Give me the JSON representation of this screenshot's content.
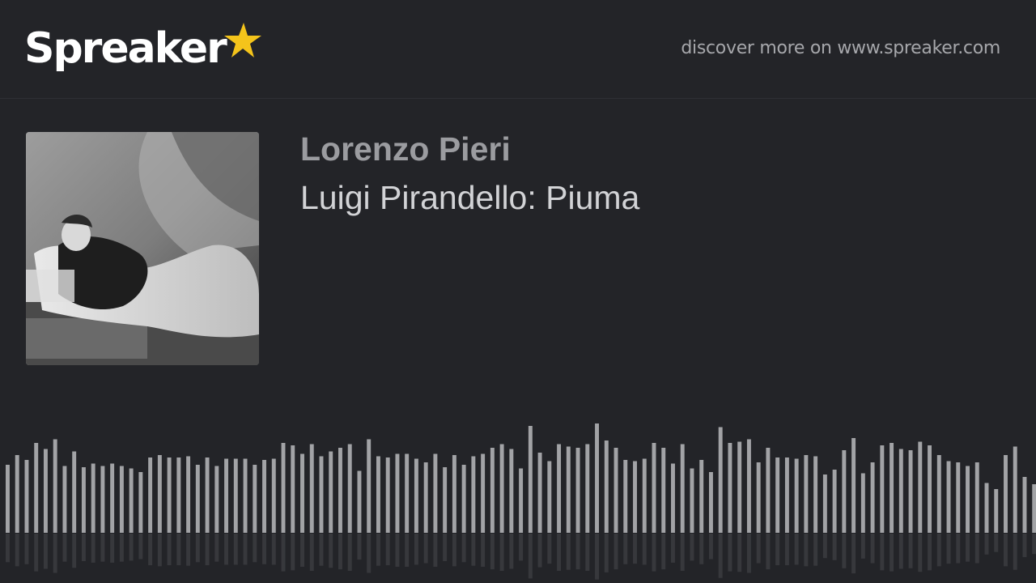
{
  "header": {
    "logo_text": "Spreaker",
    "logo_icon": "star-icon",
    "discover_text": "discover more on www.spreaker.com"
  },
  "episode": {
    "author": "Lorenzo Pieri",
    "title": "Luigi Pirandello: Piuma",
    "cover_icon": "cover-art"
  },
  "colors": {
    "background": "#232428",
    "star": "#f4c41b",
    "waveform_bar": "#a2a3a6",
    "author": "#9b9ca0",
    "title": "#d2d3d6"
  },
  "waveform": {
    "levels": [
      0.56,
      0.64,
      0.6,
      0.74,
      0.69,
      0.77,
      0.55,
      0.67,
      0.54,
      0.57,
      0.55,
      0.57,
      0.55,
      0.53,
      0.5,
      0.62,
      0.64,
      0.62,
      0.62,
      0.63,
      0.56,
      0.62,
      0.55,
      0.61,
      0.61,
      0.61,
      0.56,
      0.6,
      0.61,
      0.74,
      0.72,
      0.65,
      0.73,
      0.63,
      0.67,
      0.7,
      0.73,
      0.51,
      0.77,
      0.63,
      0.62,
      0.65,
      0.65,
      0.61,
      0.58,
      0.65,
      0.54,
      0.64,
      0.56,
      0.63,
      0.65,
      0.7,
      0.73,
      0.69,
      0.53,
      0.88,
      0.66,
      0.59,
      0.73,
      0.71,
      0.7,
      0.73,
      0.9,
      0.76,
      0.7,
      0.6,
      0.59,
      0.61,
      0.74,
      0.7,
      0.57,
      0.73,
      0.53,
      0.6,
      0.5,
      0.87,
      0.74,
      0.75,
      0.77,
      0.58,
      0.7,
      0.62,
      0.62,
      0.61,
      0.64,
      0.63,
      0.48,
      0.52,
      0.68,
      0.78,
      0.49,
      0.58,
      0.72,
      0.74,
      0.69,
      0.68,
      0.75,
      0.72,
      0.64,
      0.59,
      0.58,
      0.55,
      0.58,
      0.41,
      0.36,
      0.64,
      0.71,
      0.46,
      0.4
    ]
  }
}
